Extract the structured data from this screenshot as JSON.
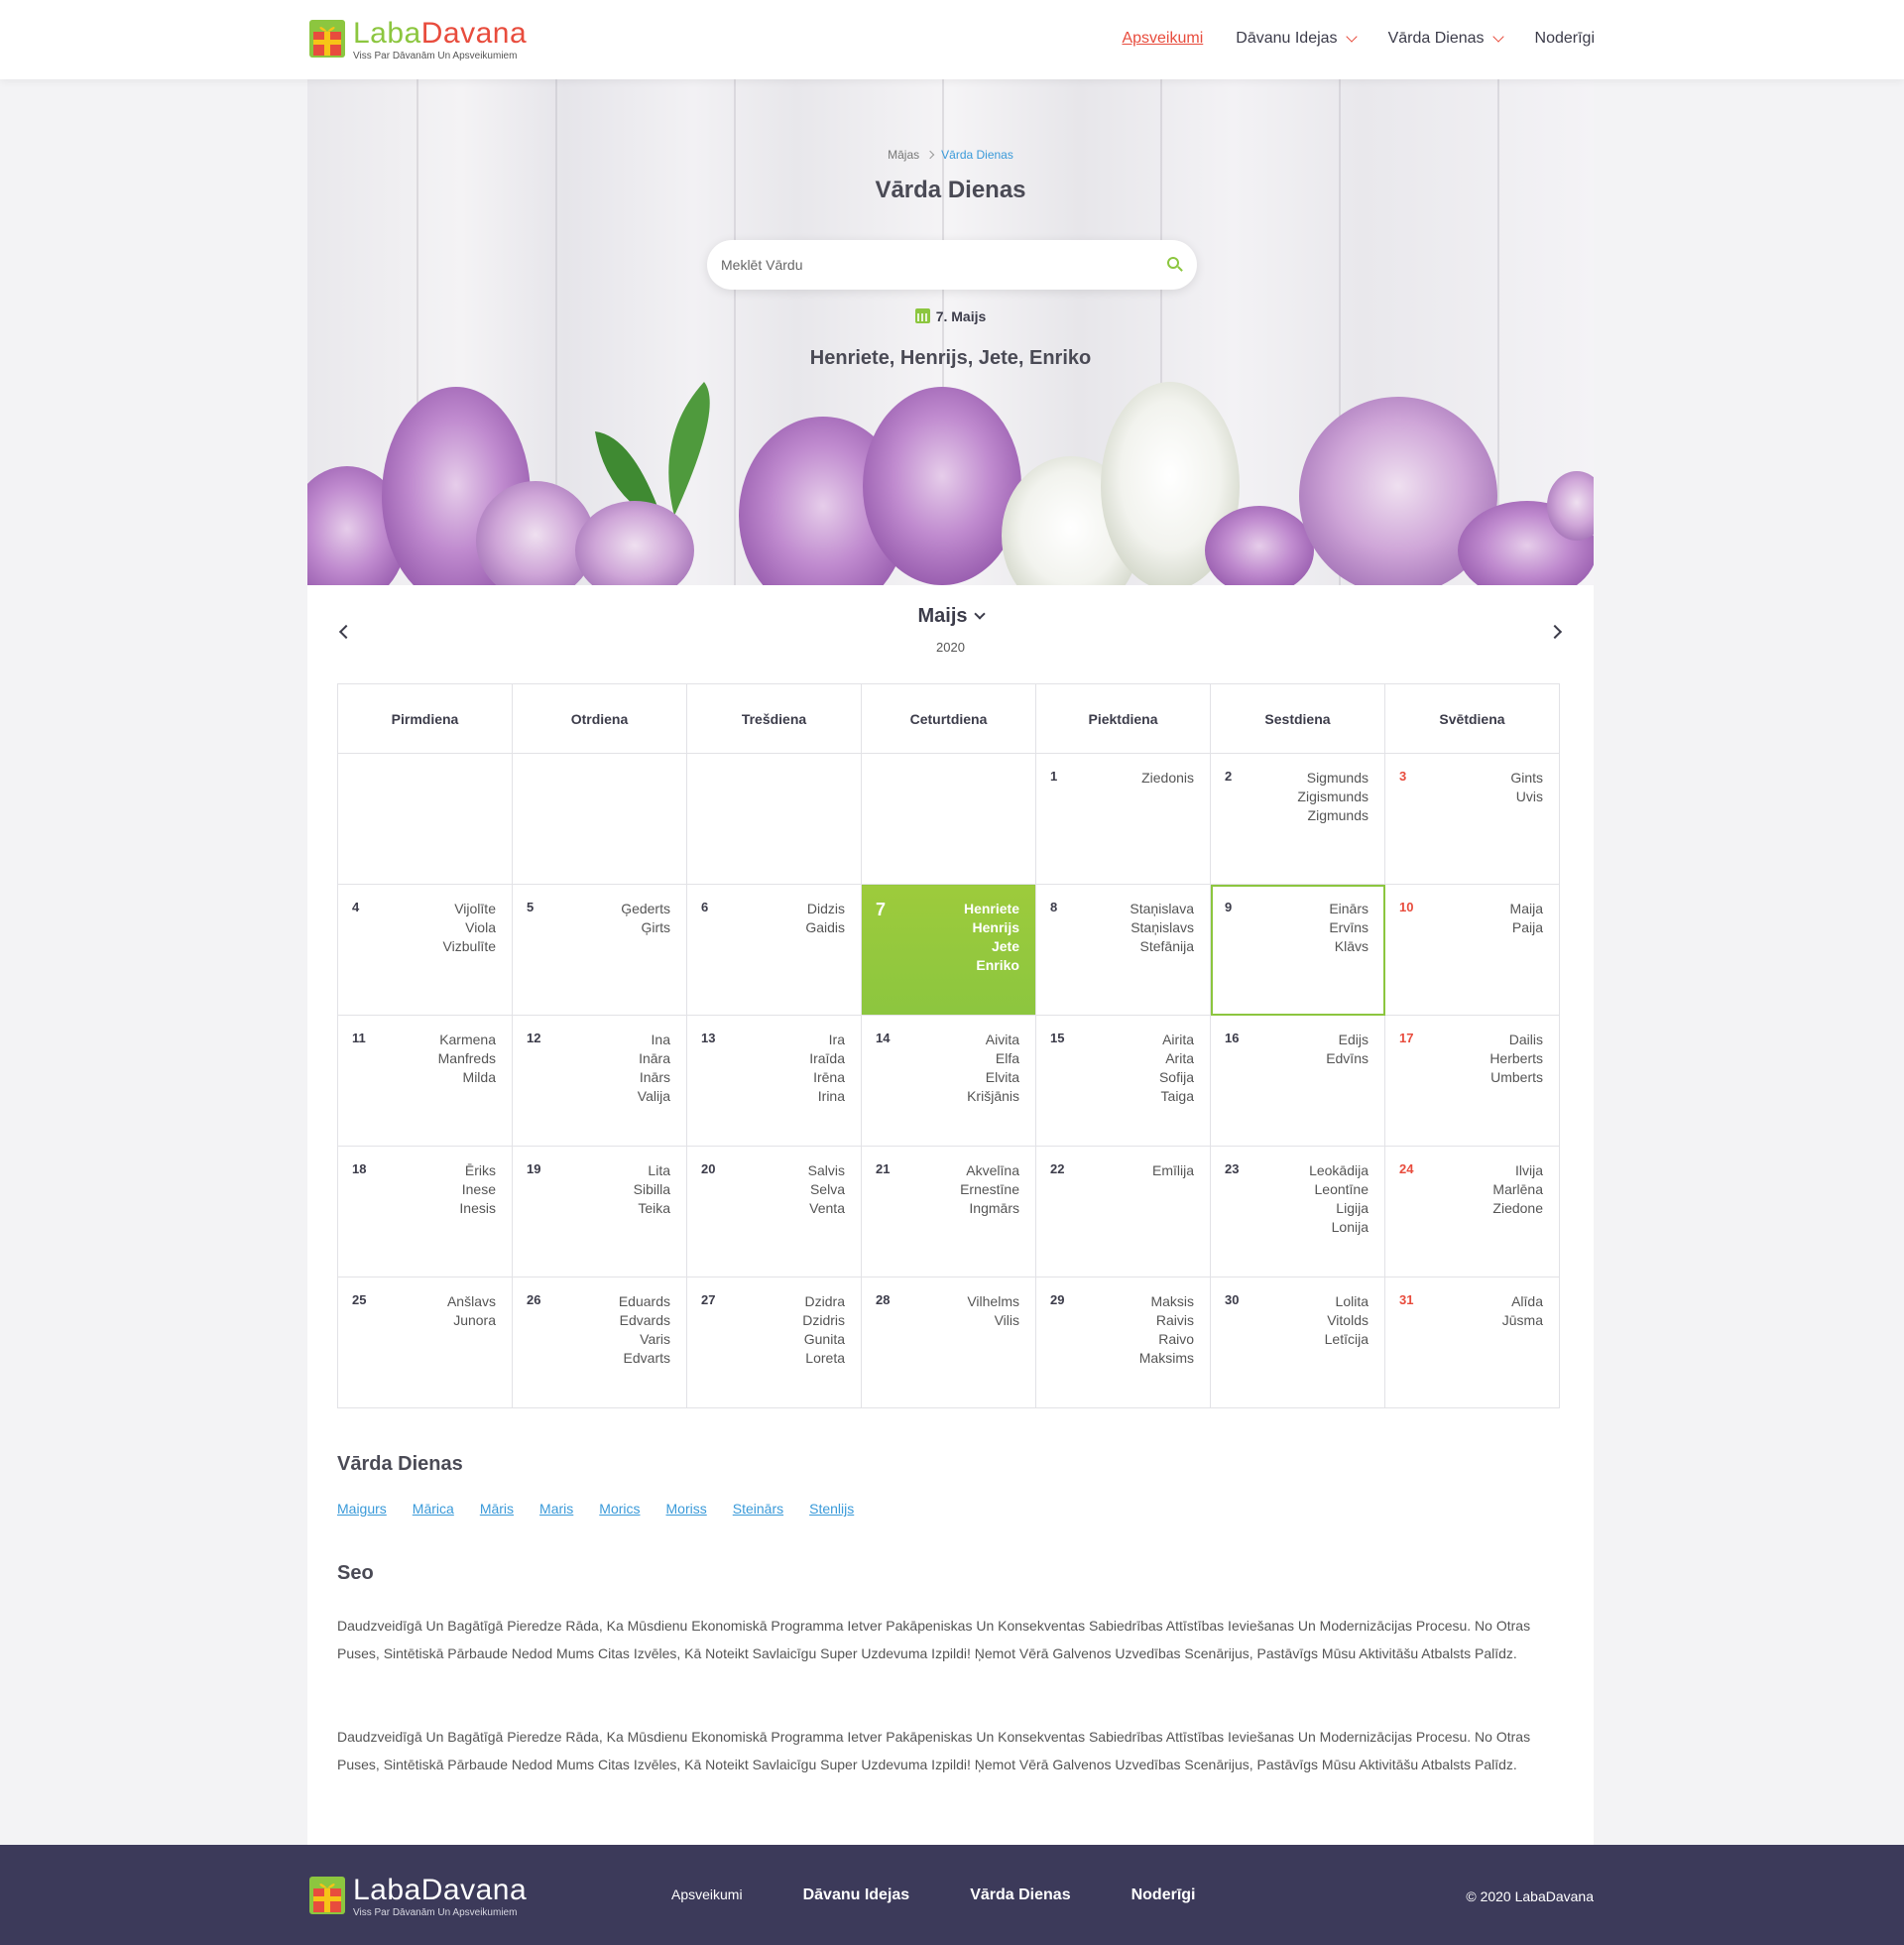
{
  "brand": {
    "name_part1": "Laba",
    "name_part2": "Davana",
    "tagline": "Viss Par Dāvanām Un Apsveikumiem",
    "accent_green": "#8cc63f",
    "accent_red": "#e84c3d"
  },
  "nav": {
    "items": [
      "Apsveikumi",
      "Dāvanu Idejas",
      "Vārda Dienas",
      "Noderīgi"
    ]
  },
  "hero": {
    "breadcrumb_home": "Mājas",
    "breadcrumb_current": "Vārda Dienas",
    "title": "Vārda Dienas",
    "search_placeholder": "Meklēt Vārdu",
    "today_date": "7. Maijs",
    "today_names": "Henriete, Henrijs, Jete, Enriko"
  },
  "calendar": {
    "month": "Maijs",
    "year": "2020",
    "weekdays": [
      "Pirmdiena",
      "Otrdiena",
      "Trešdiena",
      "Ceturtdiena",
      "Piektdiena",
      "Sestdiena",
      "Svētdiena"
    ],
    "weeks": [
      [
        null,
        null,
        null,
        null,
        {
          "day": "1",
          "names": [
            "Ziedonis"
          ]
        },
        {
          "day": "2",
          "names": [
            "Sigmunds",
            "Zigismunds",
            "Zigmunds"
          ]
        },
        {
          "day": "3",
          "names": [
            "Gints",
            "Uvis"
          ]
        }
      ],
      [
        {
          "day": "4",
          "names": [
            "Vijolīte",
            "Viola",
            "Vizbulīte"
          ]
        },
        {
          "day": "5",
          "names": [
            "Ģederts",
            "Ģirts"
          ]
        },
        {
          "day": "6",
          "names": [
            "Didzis",
            "Gaidis"
          ]
        },
        {
          "day": "7",
          "names": [
            "Henriete",
            "Henrijs",
            "Jete",
            "Enriko"
          ],
          "today": true
        },
        {
          "day": "8",
          "names": [
            "Staņislava",
            "Staņislavs",
            "Stefānija"
          ]
        },
        {
          "day": "9",
          "names": [
            "Einārs",
            "Ervīns",
            "Klāvs"
          ],
          "highlight": true
        },
        {
          "day": "10",
          "names": [
            "Maija",
            "Paija"
          ]
        }
      ],
      [
        {
          "day": "11",
          "names": [
            "Karmena",
            "Manfreds",
            "Milda"
          ]
        },
        {
          "day": "12",
          "names": [
            "Ina",
            "Ināra",
            "Inārs",
            "Valija"
          ]
        },
        {
          "day": "13",
          "names": [
            "Ira",
            "Iraīda",
            "Irēna",
            "Irina"
          ]
        },
        {
          "day": "14",
          "names": [
            "Aivita",
            "Elfa",
            "Elvita",
            "Krišjānis"
          ]
        },
        {
          "day": "15",
          "names": [
            "Airita",
            "Arita",
            "Sofija",
            "Taiga"
          ]
        },
        {
          "day": "16",
          "names": [
            "Edijs",
            "Edvīns"
          ]
        },
        {
          "day": "17",
          "names": [
            "Dailis",
            "Herberts",
            "Umberts"
          ]
        }
      ],
      [
        {
          "day": "18",
          "names": [
            "Ēriks",
            "Inese",
            "Inesis"
          ]
        },
        {
          "day": "19",
          "names": [
            "Lita",
            "Sibilla",
            "Teika"
          ]
        },
        {
          "day": "20",
          "names": [
            "Salvis",
            "Selva",
            "Venta"
          ]
        },
        {
          "day": "21",
          "names": [
            "Akvelīna",
            "Ernestīne",
            "Ingmārs"
          ]
        },
        {
          "day": "22",
          "names": [
            "Emīlija"
          ]
        },
        {
          "day": "23",
          "names": [
            "Leokādija",
            "Leontīne",
            "Ligija",
            "Lonija"
          ]
        },
        {
          "day": "24",
          "names": [
            "Ilvija",
            "Marlēna",
            "Ziedone"
          ]
        }
      ],
      [
        {
          "day": "25",
          "names": [
            "Anšlavs",
            "Junora"
          ]
        },
        {
          "day": "26",
          "names": [
            "Eduards",
            "Edvards",
            "Varis",
            "Edvarts"
          ]
        },
        {
          "day": "27",
          "names": [
            "Dzidra",
            "Dzidris",
            "Gunita",
            "Loreta"
          ]
        },
        {
          "day": "28",
          "names": [
            "Vilhelms",
            "Vilis"
          ]
        },
        {
          "day": "29",
          "names": [
            "Maksis",
            "Raivis",
            "Raivo",
            "Maksims"
          ]
        },
        {
          "day": "30",
          "names": [
            "Lolita",
            "Vitolds",
            "Letīcija"
          ]
        },
        {
          "day": "31",
          "names": [
            "Alīda",
            "Jūsma"
          ]
        }
      ]
    ]
  },
  "name_days_section": {
    "title": "Vārda Dienas",
    "links": [
      "Maigurs",
      "Mārica",
      "Māris",
      "Maris",
      "Morics",
      "Moriss",
      "Steinārs",
      "Stenlijs"
    ]
  },
  "seo": {
    "title": "Seo",
    "paragraphs": [
      "Daudzveidīgā Un Bagātīgā Pieredze Rāda, Ka Mūsdienu Ekonomiskā Programma Ietver Pakāpeniskas Un Konsekventas Sabiedrības Attīstības Ieviešanas Un Modernizācijas Procesu. No Otras Puses, Sintētiskā Pārbaude Nedod Mums Citas Izvēles, Kā Noteikt Savlaicīgu Super Uzdevuma Izpildi! Ņemot Vērā Galvenos Uzvedības Scenārijus, Pastāvīgs Mūsu Aktivitāšu Atbalsts Palīdz.",
      "Daudzveidīgā Un Bagātīgā Pieredze Rāda, Ka Mūsdienu Ekonomiskā Programma Ietver Pakāpeniskas Un Konsekventas Sabiedrības Attīstības Ieviešanas Un Modernizācijas Procesu. No Otras Puses, Sintētiskā Pārbaude Nedod Mums Citas Izvēles, Kā Noteikt Savlaicīgu Super Uzdevuma Izpildi! Ņemot Vērā Galvenos Uzvedības Scenārijus, Pastāvīgs Mūsu Aktivitāšu Atbalsts Palīdz."
    ]
  },
  "footer": {
    "nav": [
      "Apsveikumi",
      "Dāvanu Idejas",
      "Vārda Dienas",
      "Noderīgi"
    ],
    "copyright": "© 2020 LabaDavana",
    "background": "#3c3a5a"
  }
}
